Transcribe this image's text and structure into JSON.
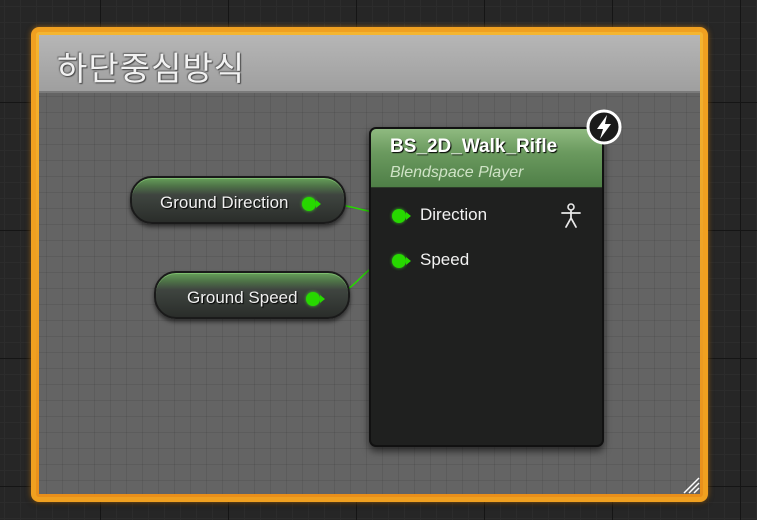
{
  "comment": {
    "title": "하단중심방식"
  },
  "variables": [
    {
      "label": "Ground Direction"
    },
    {
      "label": "Ground Speed"
    }
  ],
  "blendspace_node": {
    "title": "BS_2D_Walk_Rifle",
    "subtitle": "Blendspace Player",
    "pins": [
      {
        "label": "Direction"
      },
      {
        "label": "Speed"
      }
    ],
    "badge_icon": "lightning-icon",
    "pin_icon": "person-icon"
  },
  "colors": {
    "comment_border": "#f0a020",
    "comment_header": "#aaaaaa",
    "float_pin": "#27d800",
    "node_header": "#6b9a5f"
  }
}
